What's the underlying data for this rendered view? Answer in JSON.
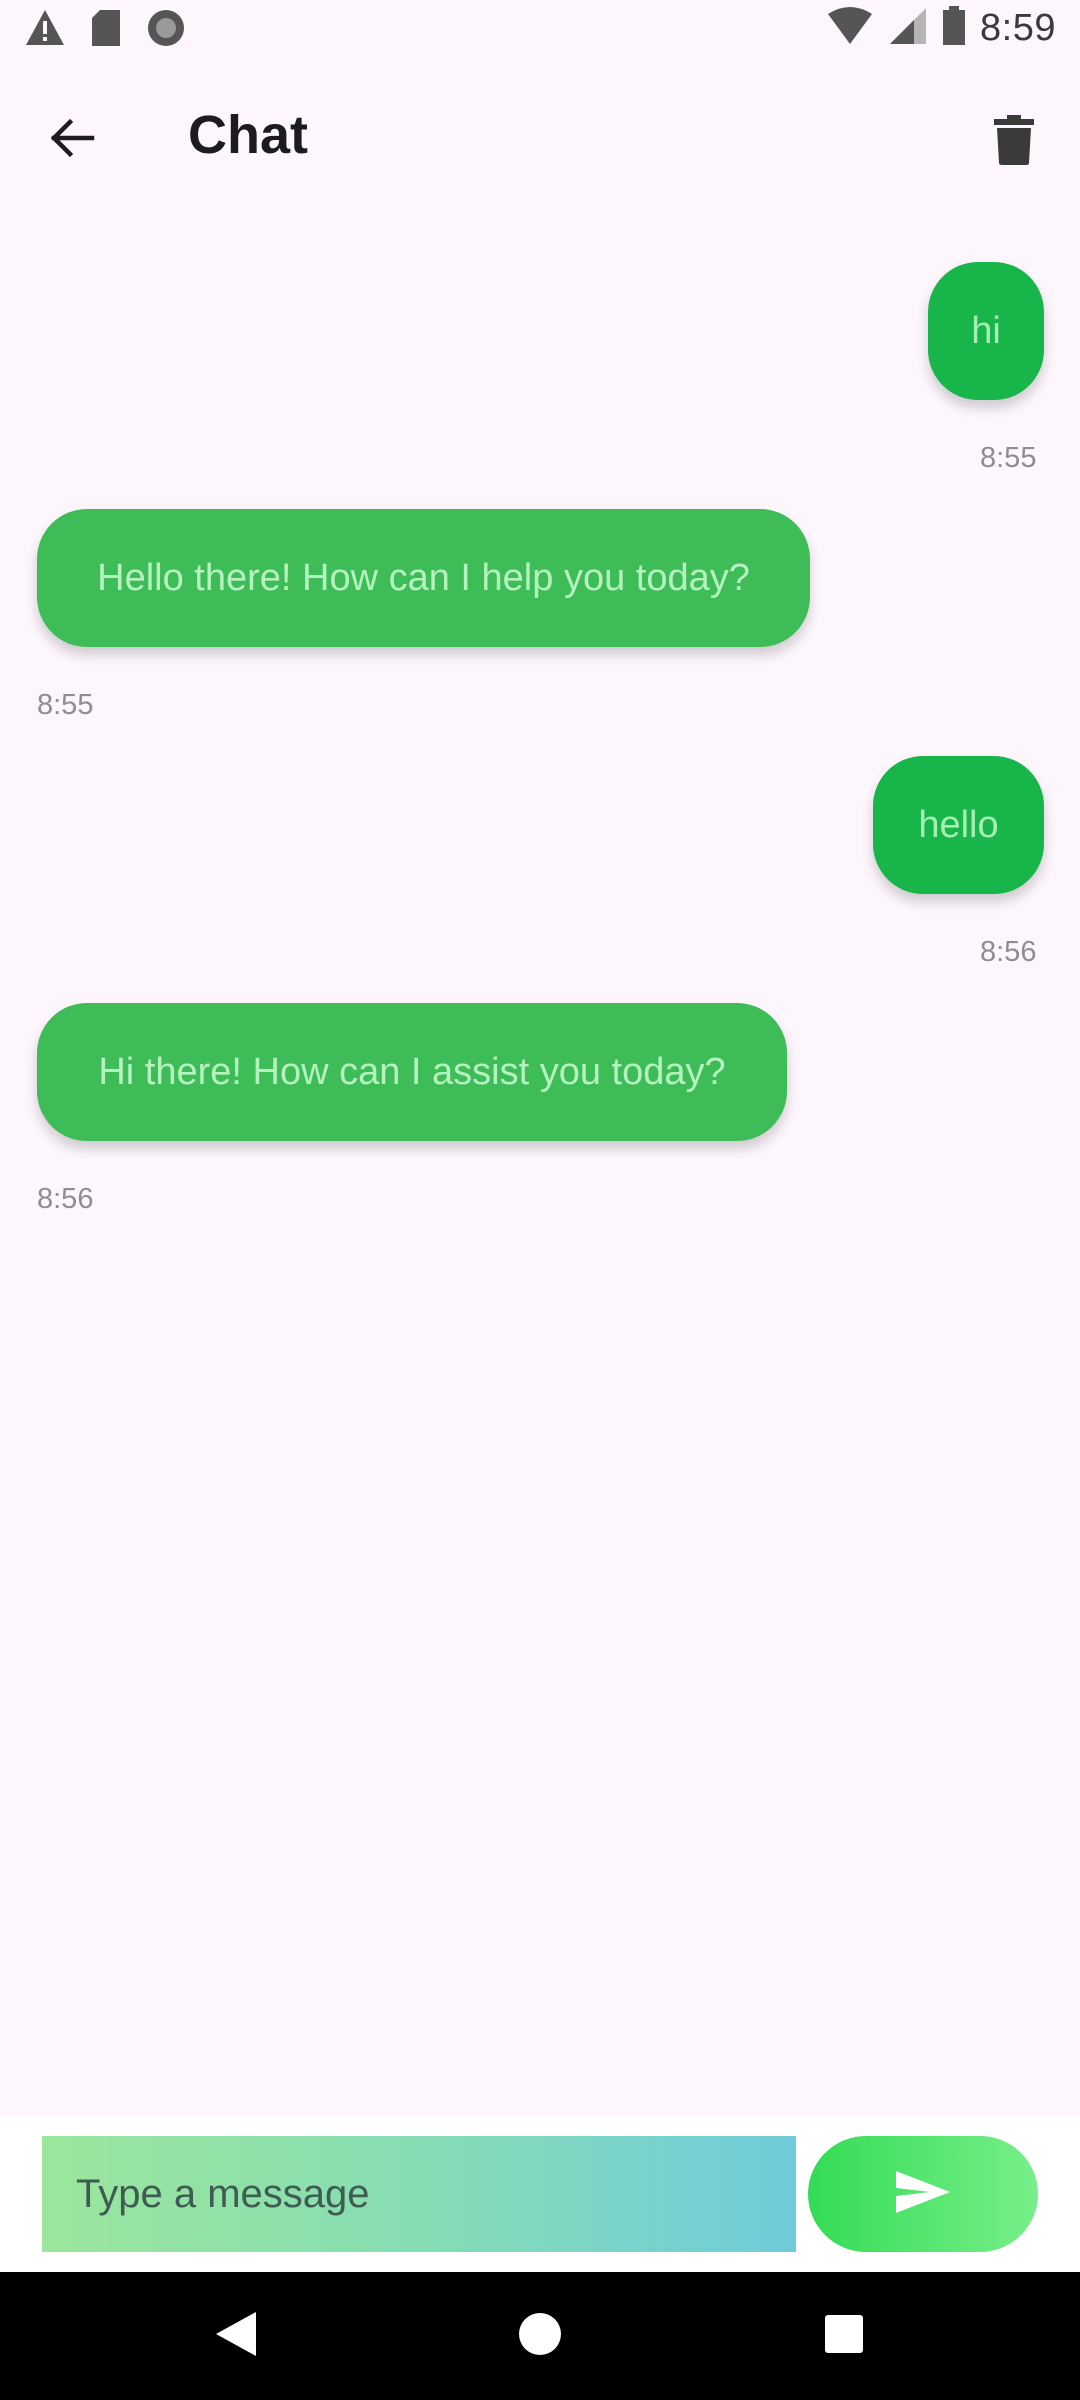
{
  "status_bar": {
    "time": "8:59",
    "left_icons": [
      "warning-icon",
      "sd-card-icon",
      "record-icon"
    ],
    "right_icons": [
      "wifi-icon",
      "cell-signal-icon",
      "battery-icon"
    ]
  },
  "app_bar": {
    "title": "Chat",
    "back_icon": "arrow-back-icon",
    "delete_icon": "trash-icon"
  },
  "messages": [
    {
      "sender": "user",
      "text": "hi",
      "time": "8:55"
    },
    {
      "sender": "bot",
      "text": "Hello there! How can I help you today?",
      "time": "8:55"
    },
    {
      "sender": "user",
      "text": "hello",
      "time": "8:56"
    },
    {
      "sender": "bot",
      "text": "Hi there! How can I assist you today?",
      "time": "8:56"
    }
  ],
  "input": {
    "placeholder": "Type a message",
    "value": "",
    "send_icon": "send-icon"
  },
  "nav_bar": {
    "icons": [
      "nav-back-icon",
      "nav-home-icon",
      "nav-recents-icon"
    ]
  },
  "colors": {
    "background": "#FDF7FD",
    "user_bubble": "#17B54A",
    "bot_bubble": "#3DBC58",
    "timestamp": "#8E8E8E"
  }
}
